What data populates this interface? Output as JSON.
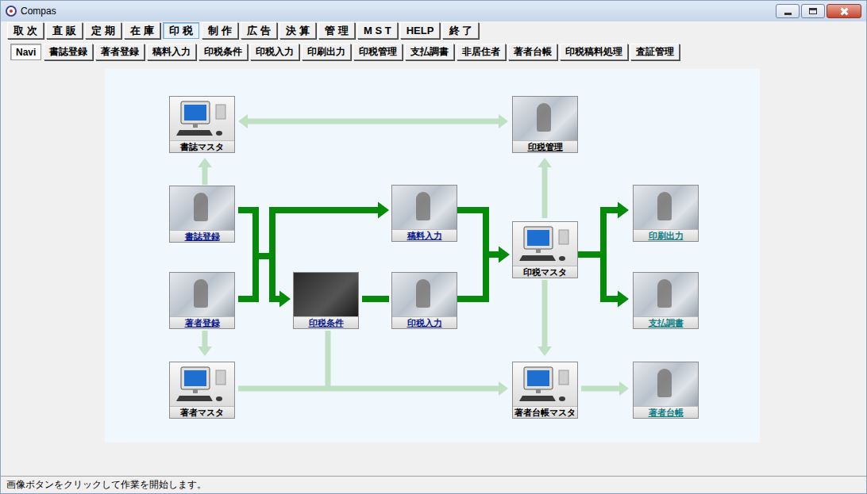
{
  "window": {
    "title": "Compas"
  },
  "menu": [
    {
      "label": "取 次",
      "selected": false
    },
    {
      "label": "直 販",
      "selected": false
    },
    {
      "label": "定 期",
      "selected": false
    },
    {
      "label": "在 庫",
      "selected": false
    },
    {
      "label": "印 税",
      "selected": true
    },
    {
      "label": "制 作",
      "selected": false
    },
    {
      "label": "広 告",
      "selected": false
    },
    {
      "label": "決 算",
      "selected": false
    },
    {
      "label": "管 理",
      "selected": false
    },
    {
      "label": "M S T",
      "selected": false
    },
    {
      "label": "HELP",
      "selected": false
    },
    {
      "label": "終 了",
      "selected": false
    }
  ],
  "subtabs": [
    {
      "label": "Navi",
      "selected": true
    },
    {
      "label": "書誌登録",
      "selected": false
    },
    {
      "label": "著者登録",
      "selected": false
    },
    {
      "label": "稿料入力",
      "selected": false
    },
    {
      "label": "印税条件",
      "selected": false
    },
    {
      "label": "印税入力",
      "selected": false
    },
    {
      "label": "印刷出力",
      "selected": false
    },
    {
      "label": "印税管理",
      "selected": false
    },
    {
      "label": "支払調書",
      "selected": false
    },
    {
      "label": "非居住者",
      "selected": false
    },
    {
      "label": "著者台帳",
      "selected": false
    },
    {
      "label": "印税稿料処理",
      "selected": false
    },
    {
      "label": "査証管理",
      "selected": false
    }
  ],
  "diagram": {
    "nodes": [
      {
        "label": "書誌マスタ",
        "kind": "master",
        "color": "#000000"
      },
      {
        "label": "印税管理",
        "kind": "photo",
        "color": "#000000"
      },
      {
        "label": "書誌登録",
        "kind": "photo",
        "color": "#0a1a8c"
      },
      {
        "label": "稿料入力",
        "kind": "photo",
        "color": "#0a1a8c"
      },
      {
        "label": "印税マスタ",
        "kind": "master",
        "color": "#000000"
      },
      {
        "label": "印刷出力",
        "kind": "photo",
        "color": "#0f7f86"
      },
      {
        "label": "著者登録",
        "kind": "photo",
        "color": "#0a1a8c"
      },
      {
        "label": "印税条件",
        "kind": "dark",
        "color": "#0a1a8c"
      },
      {
        "label": "印税入力",
        "kind": "photo",
        "color": "#0a1a8c"
      },
      {
        "label": "支払調書",
        "kind": "photo",
        "color": "#0f7f86"
      },
      {
        "label": "著者マスタ",
        "kind": "master",
        "color": "#000000"
      },
      {
        "label": "著者台帳マスタ",
        "kind": "master",
        "color": "#000000"
      },
      {
        "label": "著者台帳",
        "kind": "photo",
        "color": "#0f7f86"
      }
    ]
  },
  "status_bar": "画像ボタンをクリックして作業を開始します。"
}
